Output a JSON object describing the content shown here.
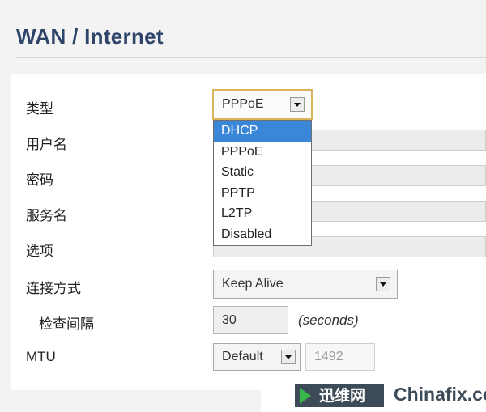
{
  "header": {
    "title": "WAN / Internet"
  },
  "form": {
    "type_label": "类型",
    "type_value": "PPPoE",
    "type_options": [
      {
        "label": "DHCP",
        "selected": true
      },
      {
        "label": "PPPoE",
        "selected": false
      },
      {
        "label": "Static",
        "selected": false
      },
      {
        "label": "PPTP",
        "selected": false
      },
      {
        "label": "L2TP",
        "selected": false
      },
      {
        "label": "Disabled",
        "selected": false
      }
    ],
    "username_label": "用户名",
    "password_label": "密码",
    "service_label": "服务名",
    "options_label": "选项",
    "connect_mode_label": "连接方式",
    "connect_mode_value": "Keep Alive",
    "check_interval_label": "检查间隔",
    "check_interval_value": "30",
    "check_interval_unit": "(seconds)",
    "mtu_label": "MTU",
    "mtu_mode_value": "Default",
    "mtu_value": "1492"
  },
  "watermark": {
    "logo_text": "迅维网",
    "site_text": "Chinafix.com"
  },
  "colors": {
    "title": "#2e4469",
    "selected": "#3a86d8",
    "focus_border": "#d9b45a"
  }
}
